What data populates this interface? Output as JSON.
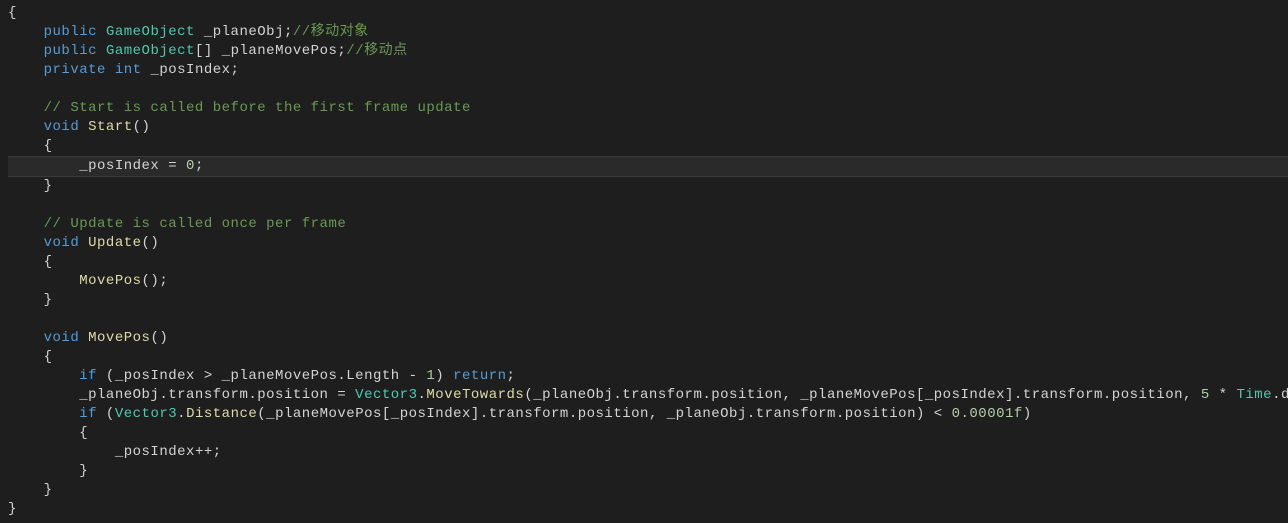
{
  "code": {
    "l1_public": "public",
    "l1_type": "GameObject",
    "l1_field": " _planeObj;",
    "l1_comment": "//移动对象",
    "l2_public": "public",
    "l2_type": "GameObject",
    "l2_brackets": "[]",
    "l2_field": " _planeMovePos;",
    "l2_comment": "//移动点",
    "l3_private": "private",
    "l3_int": "int",
    "l3_field": " _posIndex;",
    "l5_comment": "// Start is called before the first frame update",
    "l6_void": "void",
    "l6_func": " Start",
    "l6_paren": "()",
    "l7_brace_open": "{",
    "l8_body": "_posIndex = ",
    "l8_num": "0",
    "l8_semi": ";",
    "l9_brace_close": "}",
    "l11_comment": "// Update is called once per frame",
    "l12_void": "void",
    "l12_func": " Update",
    "l12_paren": "()",
    "l13_brace_open": "{",
    "l14_call": "MovePos",
    "l14_paren": "();",
    "l15_brace_close": "}",
    "l17_void": "void",
    "l17_func": " MovePos",
    "l17_paren": "()",
    "l18_brace_open": "{",
    "l19_if": "if",
    "l19_open": " (_posIndex > _planeMovePos.Length - ",
    "l19_num": "1",
    "l19_close": ") ",
    "l19_return": "return",
    "l19_semi": ";",
    "l20_a": "_planeObj.transform.position = ",
    "l20_type": "Vector3",
    "l20_dot": ".",
    "l20_func": "MoveTowards",
    "l20_b": "(_planeObj.transform.position, _planeMovePos[_posIndex].transform.position, ",
    "l20_num": "5",
    "l20_c": " * ",
    "l20_time": "Time",
    "l20_d": ".deltaTime);",
    "l21_if": "if",
    "l21_a": " (",
    "l21_type": "Vector3",
    "l21_dot": ".",
    "l21_func": "Distance",
    "l21_b": "(_planeMovePos[_posIndex].transform.position, _planeObj.transform.position) < ",
    "l21_num": "0.00001f",
    "l21_c": ")",
    "l22_brace_open": "{",
    "l23_body": "_posIndex++;",
    "l24_brace_close": "}",
    "l25_brace_close": "}",
    "l26_brace_close": "}"
  }
}
